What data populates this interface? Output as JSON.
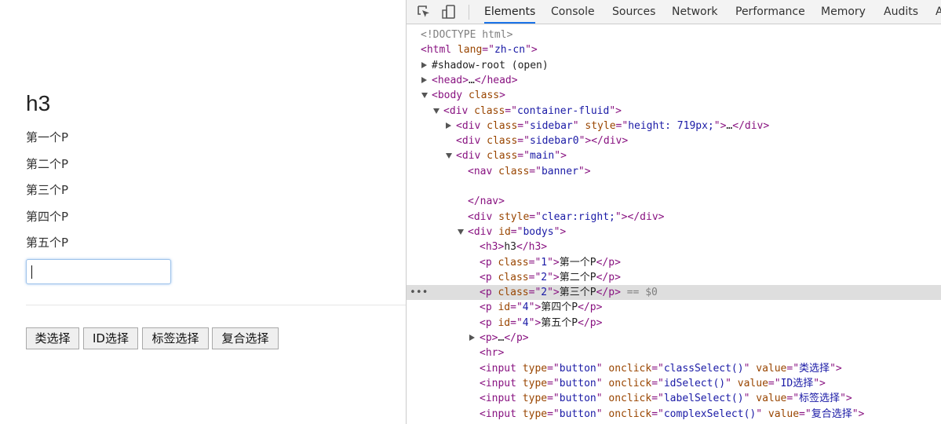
{
  "page": {
    "heading": "h3",
    "paragraphs": [
      "第一个P",
      "第二个P",
      "第三个P",
      "第四个P",
      "第五个P"
    ],
    "input_value": "",
    "buttons": [
      "类选择",
      "ID选择",
      "标签选择",
      "复合选择"
    ]
  },
  "devtools": {
    "tabs": [
      "Elements",
      "Console",
      "Sources",
      "Network",
      "Performance",
      "Memory",
      "Audits",
      "A"
    ],
    "active_tab": "Elements",
    "icons": [
      "inspect-element-icon",
      "device-toolbar-icon"
    ],
    "selected_suffix": " == $0",
    "lines": [
      {
        "parts": [
          [
            "cmt",
            "<!DOCTYPE html>"
          ]
        ]
      },
      {
        "parts": [
          [
            "tag",
            "<html "
          ],
          [
            "attr",
            "lang"
          ],
          [
            "tag",
            "=\""
          ],
          [
            "val",
            "zh-cn"
          ],
          [
            "tag",
            "\">"
          ]
        ]
      },
      {
        "parts": [
          [
            "txt",
            "#shadow-root (open)"
          ]
        ]
      },
      {
        "parts": [
          [
            "tag",
            "<head>"
          ],
          [
            "txt",
            "…"
          ],
          [
            "tag",
            "</head>"
          ]
        ]
      },
      {
        "parts": [
          [
            "tag",
            "<body "
          ],
          [
            "attr",
            "class"
          ],
          [
            "tag",
            ">"
          ]
        ]
      },
      {
        "parts": [
          [
            "tag",
            "<div "
          ],
          [
            "attr",
            "class"
          ],
          [
            "tag",
            "=\""
          ],
          [
            "val",
            "container-fluid"
          ],
          [
            "tag",
            "\">"
          ]
        ]
      },
      {
        "parts": [
          [
            "tag",
            "<div "
          ],
          [
            "attr",
            "class"
          ],
          [
            "tag",
            "=\""
          ],
          [
            "val",
            "sidebar"
          ],
          [
            "tag",
            "\" "
          ],
          [
            "attr",
            "style"
          ],
          [
            "tag",
            "=\""
          ],
          [
            "val",
            "height: 719px;"
          ],
          [
            "tag",
            "\">"
          ],
          [
            "txt",
            "…"
          ],
          [
            "tag",
            "</div>"
          ]
        ]
      },
      {
        "parts": [
          [
            "tag",
            "<div "
          ],
          [
            "attr",
            "class"
          ],
          [
            "tag",
            "=\""
          ],
          [
            "val",
            "sidebar0"
          ],
          [
            "tag",
            "\"></div>"
          ]
        ]
      },
      {
        "parts": [
          [
            "tag",
            "<div "
          ],
          [
            "attr",
            "class"
          ],
          [
            "tag",
            "=\""
          ],
          [
            "val",
            "main"
          ],
          [
            "tag",
            "\">"
          ]
        ]
      },
      {
        "parts": [
          [
            "tag",
            "<nav "
          ],
          [
            "attr",
            "class"
          ],
          [
            "tag",
            "=\""
          ],
          [
            "val",
            "banner"
          ],
          [
            "tag",
            "\">"
          ]
        ]
      },
      {
        "parts": []
      },
      {
        "parts": [
          [
            "tag",
            "</nav>"
          ]
        ]
      },
      {
        "parts": [
          [
            "tag",
            "<div "
          ],
          [
            "attr",
            "style"
          ],
          [
            "tag",
            "=\""
          ],
          [
            "val",
            "clear:right;"
          ],
          [
            "tag",
            "\"></div>"
          ]
        ]
      },
      {
        "parts": [
          [
            "tag",
            "<div "
          ],
          [
            "attr",
            "id"
          ],
          [
            "tag",
            "=\""
          ],
          [
            "val",
            "bodys"
          ],
          [
            "tag",
            "\">"
          ]
        ]
      },
      {
        "parts": [
          [
            "tag",
            "<h3>"
          ],
          [
            "txt",
            "h3"
          ],
          [
            "tag",
            "</h3>"
          ]
        ]
      },
      {
        "parts": [
          [
            "tag",
            "<p "
          ],
          [
            "attr",
            "class"
          ],
          [
            "tag",
            "=\""
          ],
          [
            "val",
            "1"
          ],
          [
            "tag",
            "\">"
          ],
          [
            "txt",
            "第一个P"
          ],
          [
            "tag",
            "</p>"
          ]
        ]
      },
      {
        "parts": [
          [
            "tag",
            "<p "
          ],
          [
            "attr",
            "class"
          ],
          [
            "tag",
            "=\""
          ],
          [
            "val",
            "2"
          ],
          [
            "tag",
            "\">"
          ],
          [
            "txt",
            "第二个P"
          ],
          [
            "tag",
            "</p>"
          ]
        ]
      },
      {
        "parts": [
          [
            "tag",
            "<p "
          ],
          [
            "attr",
            "class"
          ],
          [
            "tag",
            "=\""
          ],
          [
            "val",
            "2"
          ],
          [
            "tag",
            "\">"
          ],
          [
            "txt",
            "第三个P"
          ],
          [
            "tag",
            "</p>"
          ]
        ]
      },
      {
        "parts": [
          [
            "tag",
            "<p "
          ],
          [
            "attr",
            "id"
          ],
          [
            "tag",
            "=\""
          ],
          [
            "val",
            "4"
          ],
          [
            "tag",
            "\">"
          ],
          [
            "txt",
            "第四个P"
          ],
          [
            "tag",
            "</p>"
          ]
        ]
      },
      {
        "parts": [
          [
            "tag",
            "<p "
          ],
          [
            "attr",
            "id"
          ],
          [
            "tag",
            "=\""
          ],
          [
            "val",
            "4"
          ],
          [
            "tag",
            "\">"
          ],
          [
            "txt",
            "第五个P"
          ],
          [
            "tag",
            "</p>"
          ]
        ]
      },
      {
        "parts": [
          [
            "tag",
            "<p>"
          ],
          [
            "txt",
            "…"
          ],
          [
            "tag",
            "</p>"
          ]
        ]
      },
      {
        "parts": [
          [
            "tag",
            "<hr>"
          ]
        ]
      },
      {
        "parts": [
          [
            "tag",
            "<input "
          ],
          [
            "attr",
            "type"
          ],
          [
            "tag",
            "=\""
          ],
          [
            "val",
            "button"
          ],
          [
            "tag",
            "\" "
          ],
          [
            "attr",
            "onclick"
          ],
          [
            "tag",
            "=\""
          ],
          [
            "val",
            "classSelect()"
          ],
          [
            "tag",
            "\" "
          ],
          [
            "attr",
            "value"
          ],
          [
            "tag",
            "=\""
          ],
          [
            "val",
            "类选择"
          ],
          [
            "tag",
            "\">"
          ]
        ]
      },
      {
        "parts": [
          [
            "tag",
            "<input "
          ],
          [
            "attr",
            "type"
          ],
          [
            "tag",
            "=\""
          ],
          [
            "val",
            "button"
          ],
          [
            "tag",
            "\" "
          ],
          [
            "attr",
            "onclick"
          ],
          [
            "tag",
            "=\""
          ],
          [
            "val",
            "idSelect()"
          ],
          [
            "tag",
            "\" "
          ],
          [
            "attr",
            "value"
          ],
          [
            "tag",
            "=\""
          ],
          [
            "val",
            "ID选择"
          ],
          [
            "tag",
            "\">"
          ]
        ]
      },
      {
        "parts": [
          [
            "tag",
            "<input "
          ],
          [
            "attr",
            "type"
          ],
          [
            "tag",
            "=\""
          ],
          [
            "val",
            "button"
          ],
          [
            "tag",
            "\" "
          ],
          [
            "attr",
            "onclick"
          ],
          [
            "tag",
            "=\""
          ],
          [
            "val",
            "labelSelect()"
          ],
          [
            "tag",
            "\" "
          ],
          [
            "attr",
            "value"
          ],
          [
            "tag",
            "=\""
          ],
          [
            "val",
            "标签选择"
          ],
          [
            "tag",
            "\">"
          ]
        ]
      },
      {
        "parts": [
          [
            "tag",
            "<input "
          ],
          [
            "attr",
            "type"
          ],
          [
            "tag",
            "=\""
          ],
          [
            "val",
            "button"
          ],
          [
            "tag",
            "\" "
          ],
          [
            "attr",
            "onclick"
          ],
          [
            "tag",
            "=\""
          ],
          [
            "val",
            "complexSelect()"
          ],
          [
            "tag",
            "\" "
          ],
          [
            "attr",
            "value"
          ],
          [
            "tag",
            "=\""
          ],
          [
            "val",
            "复合选择"
          ],
          [
            "tag",
            "\">"
          ]
        ]
      }
    ]
  }
}
